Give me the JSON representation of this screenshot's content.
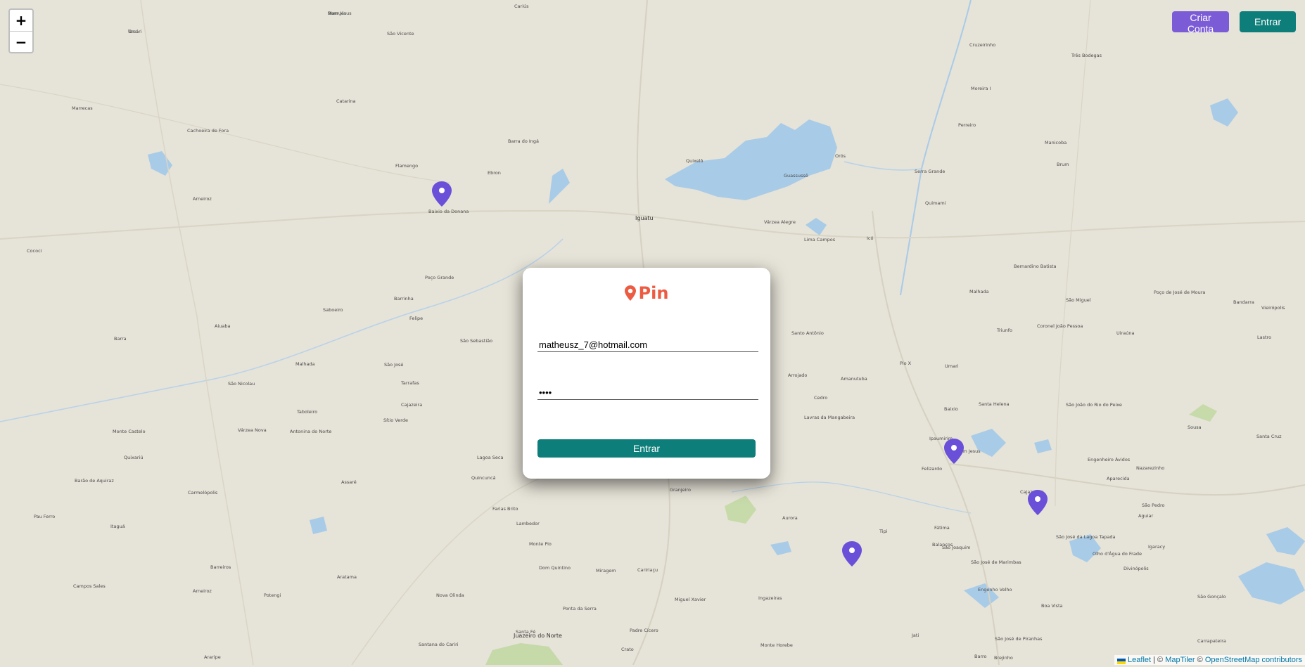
{
  "map": {
    "zoom_in_label": "+",
    "zoom_out_label": "−",
    "places": [
      "Tauá",
      "Marruás",
      "São Vicente",
      "Cariús",
      "Catarina",
      "Cachoeira de Fora",
      "Marrecas",
      "Arneiroz",
      "Flamengo",
      "Baixio da Donana",
      "Ebron",
      "Barra do Ingá",
      "Quixelô",
      "Iguatu",
      "Orós",
      "Guassussê",
      "Várzea Alegre",
      "Icó",
      "Lima Campos",
      "Cococi",
      "Poço Grande",
      "Barrinha",
      "Saboeiro",
      "Felipe",
      "São Sebastião",
      "Aiuaba",
      "Barra",
      "Malhada",
      "São José",
      "Tarrafas",
      "Cajazeira",
      "São Nicolau",
      "Taboleiro",
      "Várzea Nova",
      "Antonina do Norte",
      "Sítio Verde",
      "Monte Castelo",
      "Quixariú",
      "Lagoa Seca",
      "Quincuncá",
      "Assaré",
      "Barão de Aquiraz",
      "Carmelópolis",
      "Pau Ferro",
      "Itaguá",
      "Arneiroz",
      "Campos Sales",
      "Barreiros",
      "Aratama",
      "Potengi",
      "Araripe",
      "Nova Olinda",
      "Santana do Cariri",
      "Juazeiro do Norte",
      "Crato",
      "Farias Brito",
      "Lambedor",
      "Caririaçu",
      "Granjeiro",
      "Monte Pio",
      "Dom Quintino",
      "Miragem",
      "Ponta da Serra",
      "Santa Fé",
      "Padre Cícero",
      "Miguel Xavier",
      "Ingazeiras",
      "Aurora",
      "Lavras da Mangabeira",
      "Amanutuba",
      "Arrojado",
      "Santo Antônio",
      "Cedro",
      "Umari",
      "Baixio",
      "Ipaumirim",
      "Bom Jesus",
      "Felizardo",
      "Cajazeiras",
      "São João do Rio do Peixe",
      "Sousa",
      "Pio X",
      "Malhada",
      "Bernardino Batista",
      "Triunfo",
      "Santa Helena",
      "Tipi",
      "Fátima",
      "Balanços",
      "São Joaquim",
      "São José de Marimbas",
      "Engenho Velho",
      "Boa Vista",
      "São José de Piranhas",
      "Jati",
      "Brejinho",
      "Barro",
      "Monte Horebe",
      "Serra Grande",
      "Quimami",
      "Cruzeirinho",
      "Três Bodegas",
      "Moreira I",
      "Perreiro",
      "Manicoba",
      "Brum",
      "São Miguel",
      "Coronel João Pessoa",
      "Uiraúna",
      "Poço de José de Moura",
      "Bandarra",
      "Vieirópolis",
      "Lastro",
      "Santa Cruz",
      "São Pedro",
      "Aparecida",
      "Nazarezinho",
      "Divinópolis",
      "São Gonçalo",
      "Carrapateira",
      "Aguiar",
      "Igaracy",
      "São José da Lagoa Tapada",
      "Olho d'Água do Frade",
      "Engenheiro Ávidos",
      "Umari",
      "Bom Jesus"
    ],
    "attribution": {
      "leaflet": "Leaflet",
      "separator": " | © ",
      "maptiler": "MapTiler",
      "copy": " © ",
      "osm": "OpenStreetMap contributors"
    }
  },
  "header": {
    "criar_conta": "Criar Conta",
    "entrar": "Entrar"
  },
  "login": {
    "brand": "Pin",
    "email_value": "matheusz_7@hotmail.com",
    "password_value": "••••",
    "submit_label": "Entrar"
  },
  "colors": {
    "brand": "#ec5b42",
    "primary": "#0e7e7a",
    "secondary": "#7c5cd6",
    "pin": "#6a4fd8"
  }
}
